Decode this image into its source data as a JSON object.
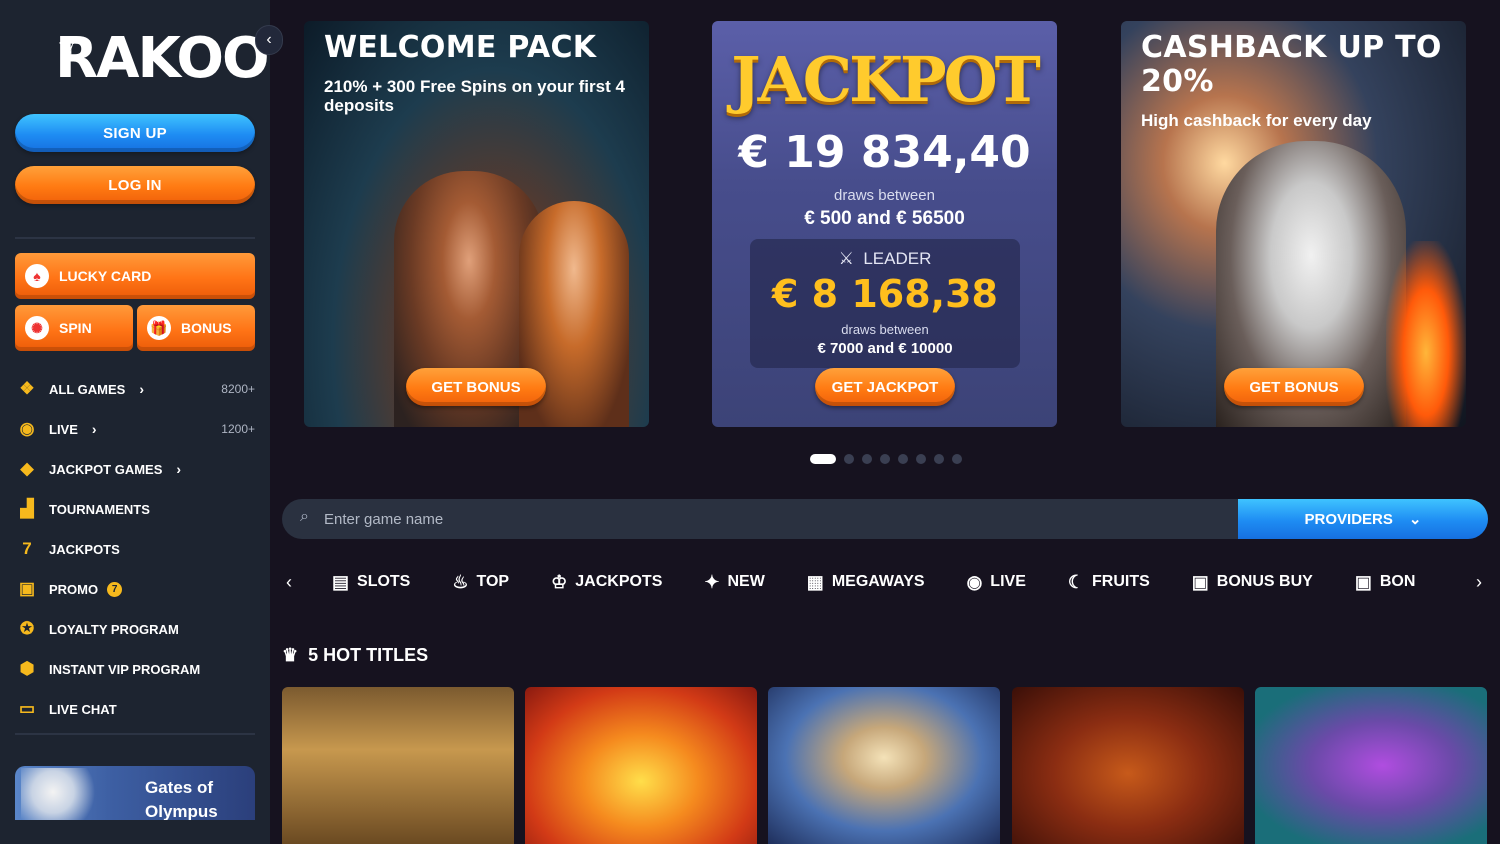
{
  "sidebar": {
    "logo_text": "RAKOO",
    "sign_up": "SIGN UP",
    "log_in": "LOG IN",
    "lucky_card": "LUCKY CARD",
    "spin": "SPIN",
    "bonus": "BONUS",
    "nav": [
      {
        "label": "ALL GAMES",
        "count": "8200+",
        "icon": "cube-icon"
      },
      {
        "label": "LIVE",
        "count": "1200+",
        "icon": "live-broadcast-icon"
      },
      {
        "label": "JACKPOT GAMES",
        "icon": "diamond-icon"
      },
      {
        "label": "TOURNAMENTS",
        "icon": "podium-icon"
      },
      {
        "label": "JACKPOTS",
        "icon": "seven-icon"
      },
      {
        "label": "PROMO",
        "badge": "7",
        "icon": "gift-icon"
      },
      {
        "label": "LOYALTY PROGRAM",
        "icon": "ribbon-icon"
      },
      {
        "label": "INSTANT VIP PROGRAM",
        "icon": "vip-shield-icon"
      },
      {
        "label": "LIVE CHAT",
        "icon": "chat-icon"
      }
    ],
    "featured_game": "Gates of Olympus"
  },
  "banners": {
    "welcome": {
      "title": "WELCOME PACK",
      "subtitle": "210% + 300 Free Spins on your first 4 deposits",
      "cta": "GET BONUS"
    },
    "jackpot": {
      "title": "JACKPOT",
      "amount": "€ 19 834,40",
      "draws_label": "draws between",
      "range": "€ 500 and € 56500",
      "leader_label": "LEADER",
      "leader_amount": "€ 8 168,38",
      "leader_draws_label": "draws between",
      "leader_range": "€ 7000 and € 10000",
      "cta": "GET JACKPOT"
    },
    "cashback": {
      "title": "CASHBACK UP TO 20%",
      "subtitle": "High cashback for every day",
      "cta": "GET BONUS"
    }
  },
  "carousel": {
    "total": 8,
    "active_index": 0
  },
  "search": {
    "placeholder": "Enter game name",
    "providers": "PROVIDERS"
  },
  "categories": [
    {
      "label": "SLOTS",
      "icon": "slot-machine-icon"
    },
    {
      "label": "TOP",
      "icon": "flame-bag-icon"
    },
    {
      "label": "JACKPOTS",
      "icon": "jackpot-machine-icon"
    },
    {
      "label": "NEW",
      "icon": "sparkle-icon"
    },
    {
      "label": "MEGAWAYS",
      "icon": "megaways-icon"
    },
    {
      "label": "LIVE",
      "icon": "live-broadcast-icon"
    },
    {
      "label": "FRUITS",
      "icon": "banana-icon"
    },
    {
      "label": "BONUS BUY",
      "icon": "gift-icon"
    },
    {
      "label": "BON",
      "icon": "gift-icon"
    }
  ],
  "hot_titles": {
    "heading": "5 HOT TITLES"
  },
  "colors": {
    "accent_orange": "#ff7a12",
    "accent_blue": "#1e8cf3",
    "sidebar_bg": "#1d2430",
    "page_bg": "#16121f",
    "icon_gold": "#f6b91d"
  }
}
